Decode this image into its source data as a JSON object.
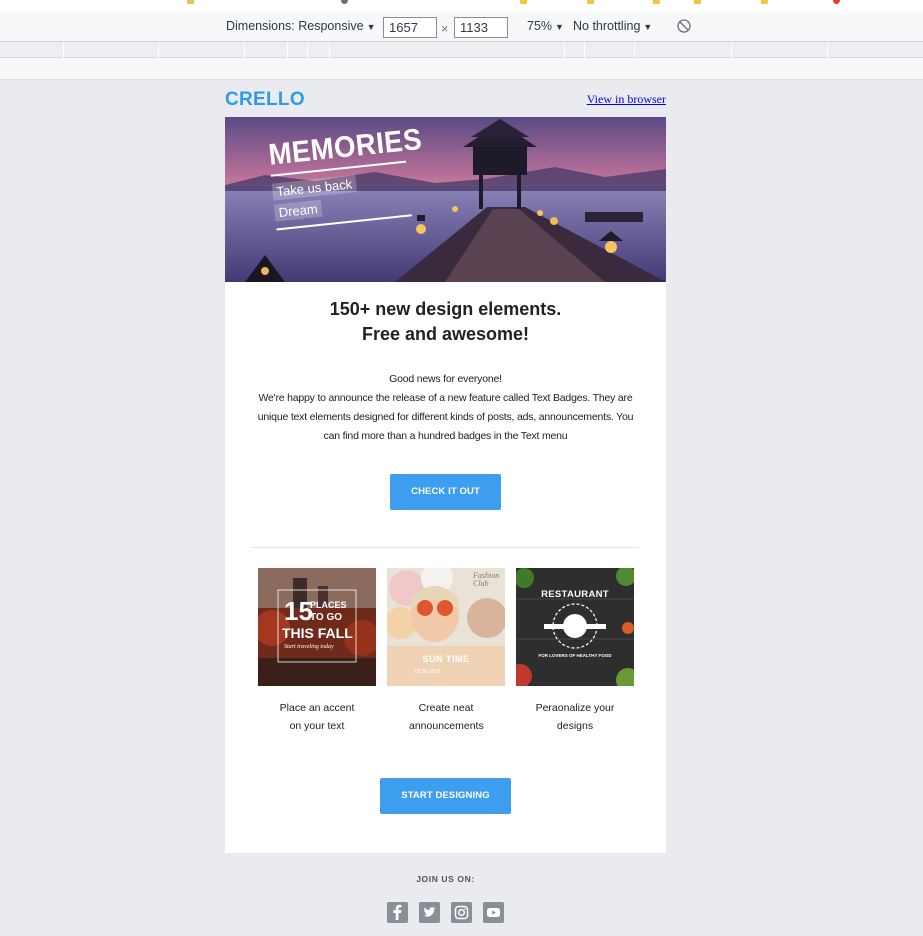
{
  "devtools": {
    "dimensions_label": "Dimensions: Responsive",
    "width_value": "1657",
    "times": "×",
    "height_value": "1133",
    "zoom": "75%",
    "throttling": "No throttling",
    "caret": "▼",
    "rotate_icon": "rotate-icon"
  },
  "email": {
    "logo": "CRELLO",
    "view_link": "View in browser",
    "hero": {
      "title": "MEMORIES",
      "line1": "Take us back",
      "line2": "Dream"
    },
    "headline_line1": "150+ new design elements.",
    "headline_line2": "Free and awesome!",
    "body_line1": "Good news for everyone!",
    "body_rest": "We're happy to announce the release of a new feature called Text Badges. They are unique text elements designed for different kinds of posts, ads, announcements. You can find more than a hundred badges in the Text menu",
    "cta_primary": "CHECK IT OUT",
    "features": [
      {
        "caption": "Place an accent on your text",
        "thumb": {
          "big": "15",
          "places": "PLACES",
          "togo": "TO GO",
          "title": "THIS FALL",
          "script": "Start traveling today"
        }
      },
      {
        "caption": "Create neat announcements",
        "thumb": {
          "brand": "Fashion Club",
          "title": "SUN TIME",
          "date": "05.06.2019"
        }
      },
      {
        "caption": "Peraonalize your designs",
        "thumb": {
          "title": "RESTAURANT",
          "tagline": "FOR LOVERS OF HEALTHY FOOD"
        }
      }
    ],
    "cta_secondary": "START DESIGNING",
    "footer": {
      "join": "JOIN US ON:",
      "social": [
        "facebook-icon",
        "twitter-icon",
        "instagram-icon",
        "youtube-icon"
      ]
    }
  },
  "colors": {
    "accent": "#3d9ef0",
    "logo": "#2f9be8",
    "page_bg": "#e9ebef"
  }
}
